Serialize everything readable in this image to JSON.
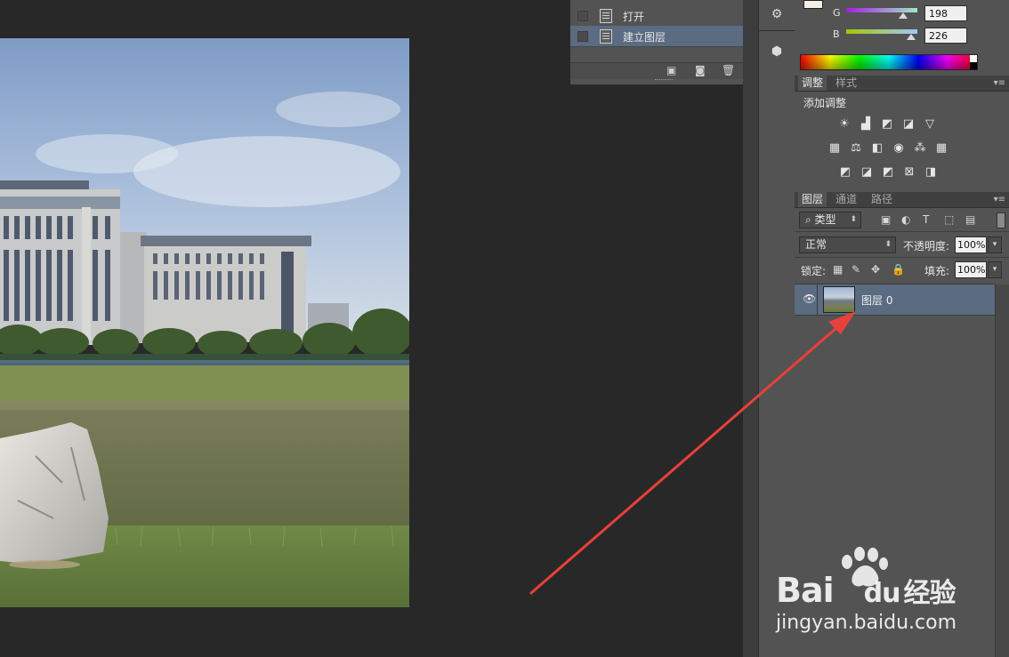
{
  "history": {
    "items": [
      {
        "label": "打开",
        "selected": false
      },
      {
        "label": "建立图层",
        "selected": true
      }
    ],
    "footer_icons": [
      "new-document-from-state-icon",
      "snapshot-camera-icon",
      "trash-icon"
    ]
  },
  "strip": {
    "icons": [
      "tool-presets-icon",
      "3d-cube-icon"
    ]
  },
  "color": {
    "g_label": "G",
    "g_value": "198",
    "b_label": "B",
    "b_value": "226"
  },
  "adjustments": {
    "tabs": [
      "调整",
      "样式"
    ],
    "heading": "添加调整",
    "icons_row1": [
      "brightness-contrast-icon",
      "levels-icon",
      "curves-icon",
      "exposure-icon",
      "vibrance-icon"
    ],
    "icons_row2": [
      "hue-saturation-icon",
      "color-balance-icon",
      "black-white-icon",
      "photo-filter-icon",
      "channel-mixer-icon",
      "color-lookup-icon"
    ],
    "icons_row3": [
      "invert-icon",
      "posterize-icon",
      "threshold-icon",
      "selective-color-icon",
      "gradient-map-icon"
    ]
  },
  "layers": {
    "tabs": [
      "图层",
      "通道",
      "路径"
    ],
    "filter_label": "类型",
    "blend_mode": "正常",
    "opacity_label": "不透明度:",
    "opacity_value": "100%",
    "lock_label": "锁定:",
    "fill_label": "填充:",
    "fill_value": "100%",
    "layer_name": "图层 0"
  },
  "watermark": {
    "brand": "Bai",
    "brand2": "du",
    "brand_cn": "经验",
    "url": "jingyan.baidu.com"
  },
  "colors": {
    "selection": "#5a6b82",
    "panel": "#535353",
    "canvas_bg": "#282828",
    "arrow": "#e8403a"
  }
}
